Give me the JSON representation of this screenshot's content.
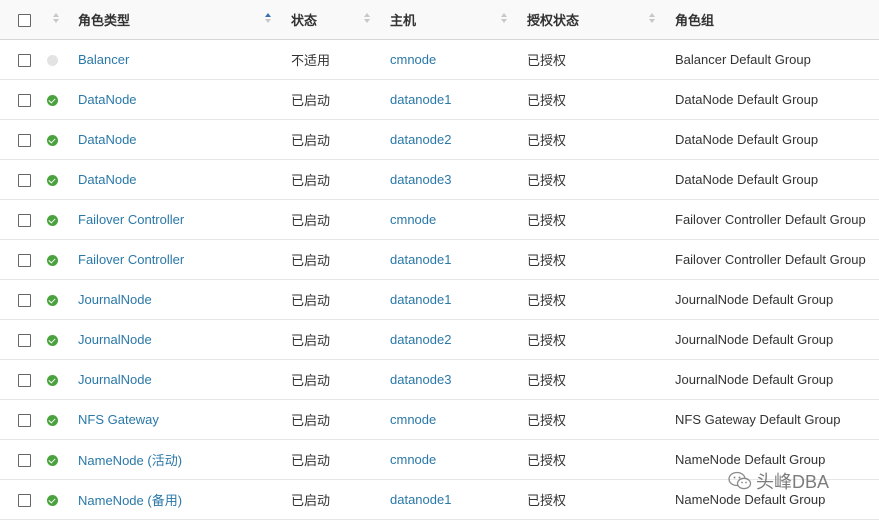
{
  "headers": {
    "type": "角色类型",
    "state": "状态",
    "host": "主机",
    "auth": "授权状态",
    "group": "角色组"
  },
  "rows": [
    {
      "status": "none",
      "type": "Balancer",
      "state": "不适用",
      "host": "cmnode",
      "auth": "已授权",
      "group": "Balancer Default Group"
    },
    {
      "status": "good",
      "type": "DataNode",
      "state": "已启动",
      "host": "datanode1",
      "auth": "已授权",
      "group": "DataNode Default Group"
    },
    {
      "status": "good",
      "type": "DataNode",
      "state": "已启动",
      "host": "datanode2",
      "auth": "已授权",
      "group": "DataNode Default Group"
    },
    {
      "status": "good",
      "type": "DataNode",
      "state": "已启动",
      "host": "datanode3",
      "auth": "已授权",
      "group": "DataNode Default Group"
    },
    {
      "status": "good",
      "type": "Failover Controller",
      "state": "已启动",
      "host": "cmnode",
      "auth": "已授权",
      "group": "Failover Controller Default Group"
    },
    {
      "status": "good",
      "type": "Failover Controller",
      "state": "已启动",
      "host": "datanode1",
      "auth": "已授权",
      "group": "Failover Controller Default Group"
    },
    {
      "status": "good",
      "type": "JournalNode",
      "state": "已启动",
      "host": "datanode1",
      "auth": "已授权",
      "group": "JournalNode Default Group"
    },
    {
      "status": "good",
      "type": "JournalNode",
      "state": "已启动",
      "host": "datanode2",
      "auth": "已授权",
      "group": "JournalNode Default Group"
    },
    {
      "status": "good",
      "type": "JournalNode",
      "state": "已启动",
      "host": "datanode3",
      "auth": "已授权",
      "group": "JournalNode Default Group"
    },
    {
      "status": "good",
      "type": "NFS Gateway",
      "state": "已启动",
      "host": "cmnode",
      "auth": "已授权",
      "group": "NFS Gateway Default Group"
    },
    {
      "status": "good",
      "type": "NameNode (活动)",
      "state": "已启动",
      "host": "cmnode",
      "auth": "已授权",
      "group": "NameNode Default Group"
    },
    {
      "status": "good",
      "type": "NameNode (备用)",
      "state": "已启动",
      "host": "datanode1",
      "auth": "已授权",
      "group": "NameNode Default Group"
    }
  ],
  "watermark": {
    "text": "头峰DBA",
    "icon": "wechat-icon"
  },
  "colors": {
    "link": "#2a78a8",
    "good": "#4aa23e",
    "none": "#e3e3e3",
    "sort_active": "#3a6fb0"
  }
}
